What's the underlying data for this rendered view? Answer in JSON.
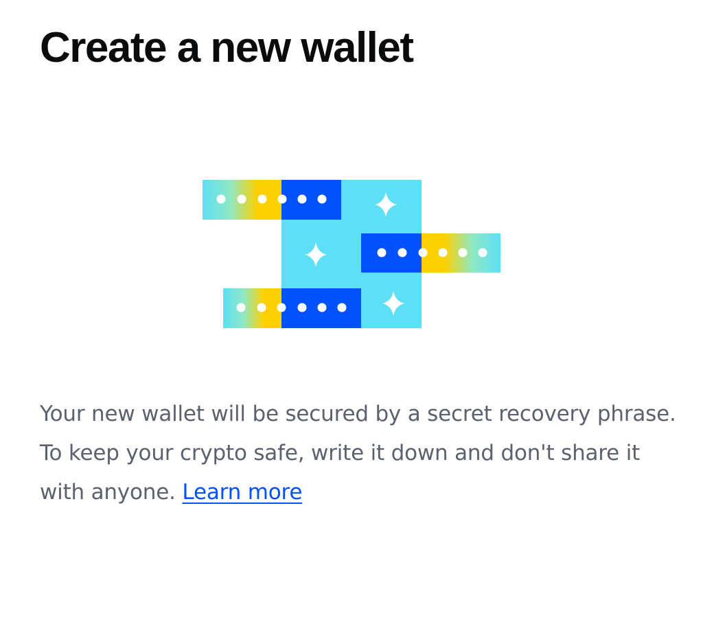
{
  "header": {
    "title": "Create a new wallet"
  },
  "illustration": {
    "icon": "wallet-recovery-phrase-illustration",
    "colors": {
      "light_blue": "#5ddff5",
      "blue": "#0052ff",
      "yellow": "#ffd000",
      "white": "#ffffff"
    }
  },
  "description": {
    "text": "Your new wallet will be secured by a secret recovery phrase. To keep your crypto safe, write it down and don't share it with anyone.",
    "link_label": "Learn more"
  },
  "theme": {
    "text_primary": "#0a0b0d",
    "text_secondary": "#5b616e",
    "link": "#0052ff",
    "background": "#ffffff"
  }
}
